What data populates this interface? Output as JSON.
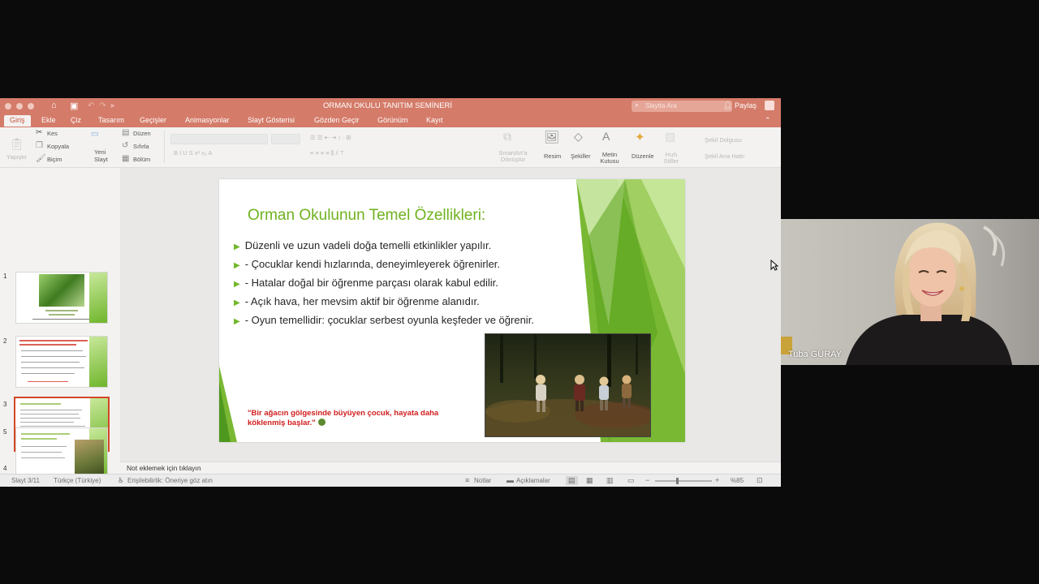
{
  "window": {
    "title": "ORMAN OKULU TANITIM SEMİNERİ",
    "search_placeholder": "Slaytta Ara",
    "share_label": "Paylaş"
  },
  "tabs": [
    {
      "label": "Giriş",
      "active": true
    },
    {
      "label": "Ekle"
    },
    {
      "label": "Çiz"
    },
    {
      "label": "Tasarım"
    },
    {
      "label": "Geçişler"
    },
    {
      "label": "Animasyonlar"
    },
    {
      "label": "Slayt Gösterisi"
    },
    {
      "label": "Gözden Geçir"
    },
    {
      "label": "Görünüm"
    },
    {
      "label": "Kayıt"
    }
  ],
  "ribbon": {
    "paste": "Yapıştır",
    "cut": "Kes",
    "copy": "Kopyala",
    "format": "Biçim",
    "new_slide": "Yeni Slayt",
    "layout": "Düzen",
    "reset": "Sıfırla",
    "section": "Bölüm",
    "convert_smartart": "SmartArt'a Dönüştür",
    "picture": "Resim",
    "shapes": "Şekiller",
    "textbox": "Metin Kutusu",
    "arrange": "Düzenle",
    "quick_styles": "Hızlı Stiller",
    "shape_fill": "Şekil Dolgusu",
    "shape_outline": "Şekil Ana Hattı"
  },
  "thumbnails": [
    {
      "number": "1"
    },
    {
      "number": "2"
    },
    {
      "number": "3",
      "selected": true
    },
    {
      "number": "4"
    },
    {
      "number": "5"
    }
  ],
  "slide": {
    "title": "Orman Okulunun Temel Özellikleri:",
    "bullets": [
      "Düzenli ve uzun vadeli doğa temelli etkinlikler yapılır.",
      "- Çocuklar kendi hızlarında, deneyimleyerek öğrenirler.",
      "- Hatalar doğal bir öğrenme parçası olarak kabul edilir.",
      "- Açık hava, her mevsim aktif bir öğrenme alanıdır.",
      "- Oyun temellidir: çocuklar serbest oyunla keşfeder ve öğrenir."
    ],
    "quote_line1": "\"Bir ağacın gölgesinde büyüyen çocuk, hayata daha",
    "quote_line2": "köklenmiş başlar.\"",
    "title_color": "#6fb21f",
    "quote_color": "#d11c1c",
    "accent_green": "#72b82a"
  },
  "notes_placeholder": "Not eklemek için tıklayın",
  "status": {
    "slide_counter": "Slayt 3/11",
    "language": "Türkçe (Türkiye)",
    "accessibility": "Erişilebilirlik: Öneriye göz atın",
    "notes": "Notlar",
    "comments": "Açıklamalar",
    "zoom": "%85"
  },
  "participant": {
    "name": "Tuba GÜRAY"
  },
  "colors": {
    "ppt_brand": "#d47b69",
    "active_tab_text": "#c8533d",
    "selection_border": "#d24726"
  }
}
